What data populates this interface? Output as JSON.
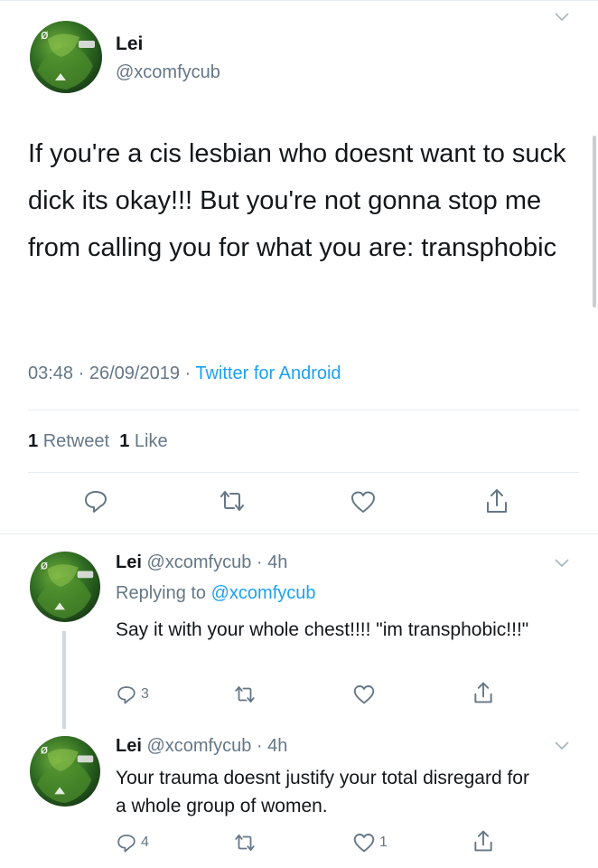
{
  "colors": {
    "accent": "#1da1f2",
    "muted": "#657786",
    "text": "#14171a",
    "divider": "#e6ecf0"
  },
  "main_tweet": {
    "display_name": "Lei",
    "handle": "@xcomfycub",
    "text": "If you're a cis lesbian who doesnt want to suck dick its okay!!! But you're not gonna stop me from calling you for what you are: transphobic",
    "time": "03:48",
    "sep1": " · ",
    "date": "26/09/2019",
    "sep2": " · ",
    "source": "Twitter for Android",
    "stats": {
      "retweets_count": "1",
      "retweets_label": "Retweet",
      "likes_count": "1",
      "likes_label": "Like"
    },
    "actions": [
      "reply-icon",
      "retweet-icon",
      "like-icon",
      "share-icon"
    ]
  },
  "replies": [
    {
      "display_name": "Lei",
      "handle": "@xcomfycub",
      "time_sep": " · ",
      "time": "4h",
      "replying_label": "Replying to",
      "replying_handle": "@xcomfycub",
      "text": "Say it with your whole chest!!!! \"im transphobic!!!\"",
      "reply_count": "3",
      "retweet_count": "",
      "like_count": ""
    },
    {
      "display_name": "Lei",
      "handle": "@xcomfycub",
      "time_sep": " · ",
      "time": "4h",
      "text": "Your trauma doesnt justify your total disregard for a whole group of women.",
      "reply_count": "4",
      "retweet_count": "",
      "like_count": "1"
    }
  ]
}
